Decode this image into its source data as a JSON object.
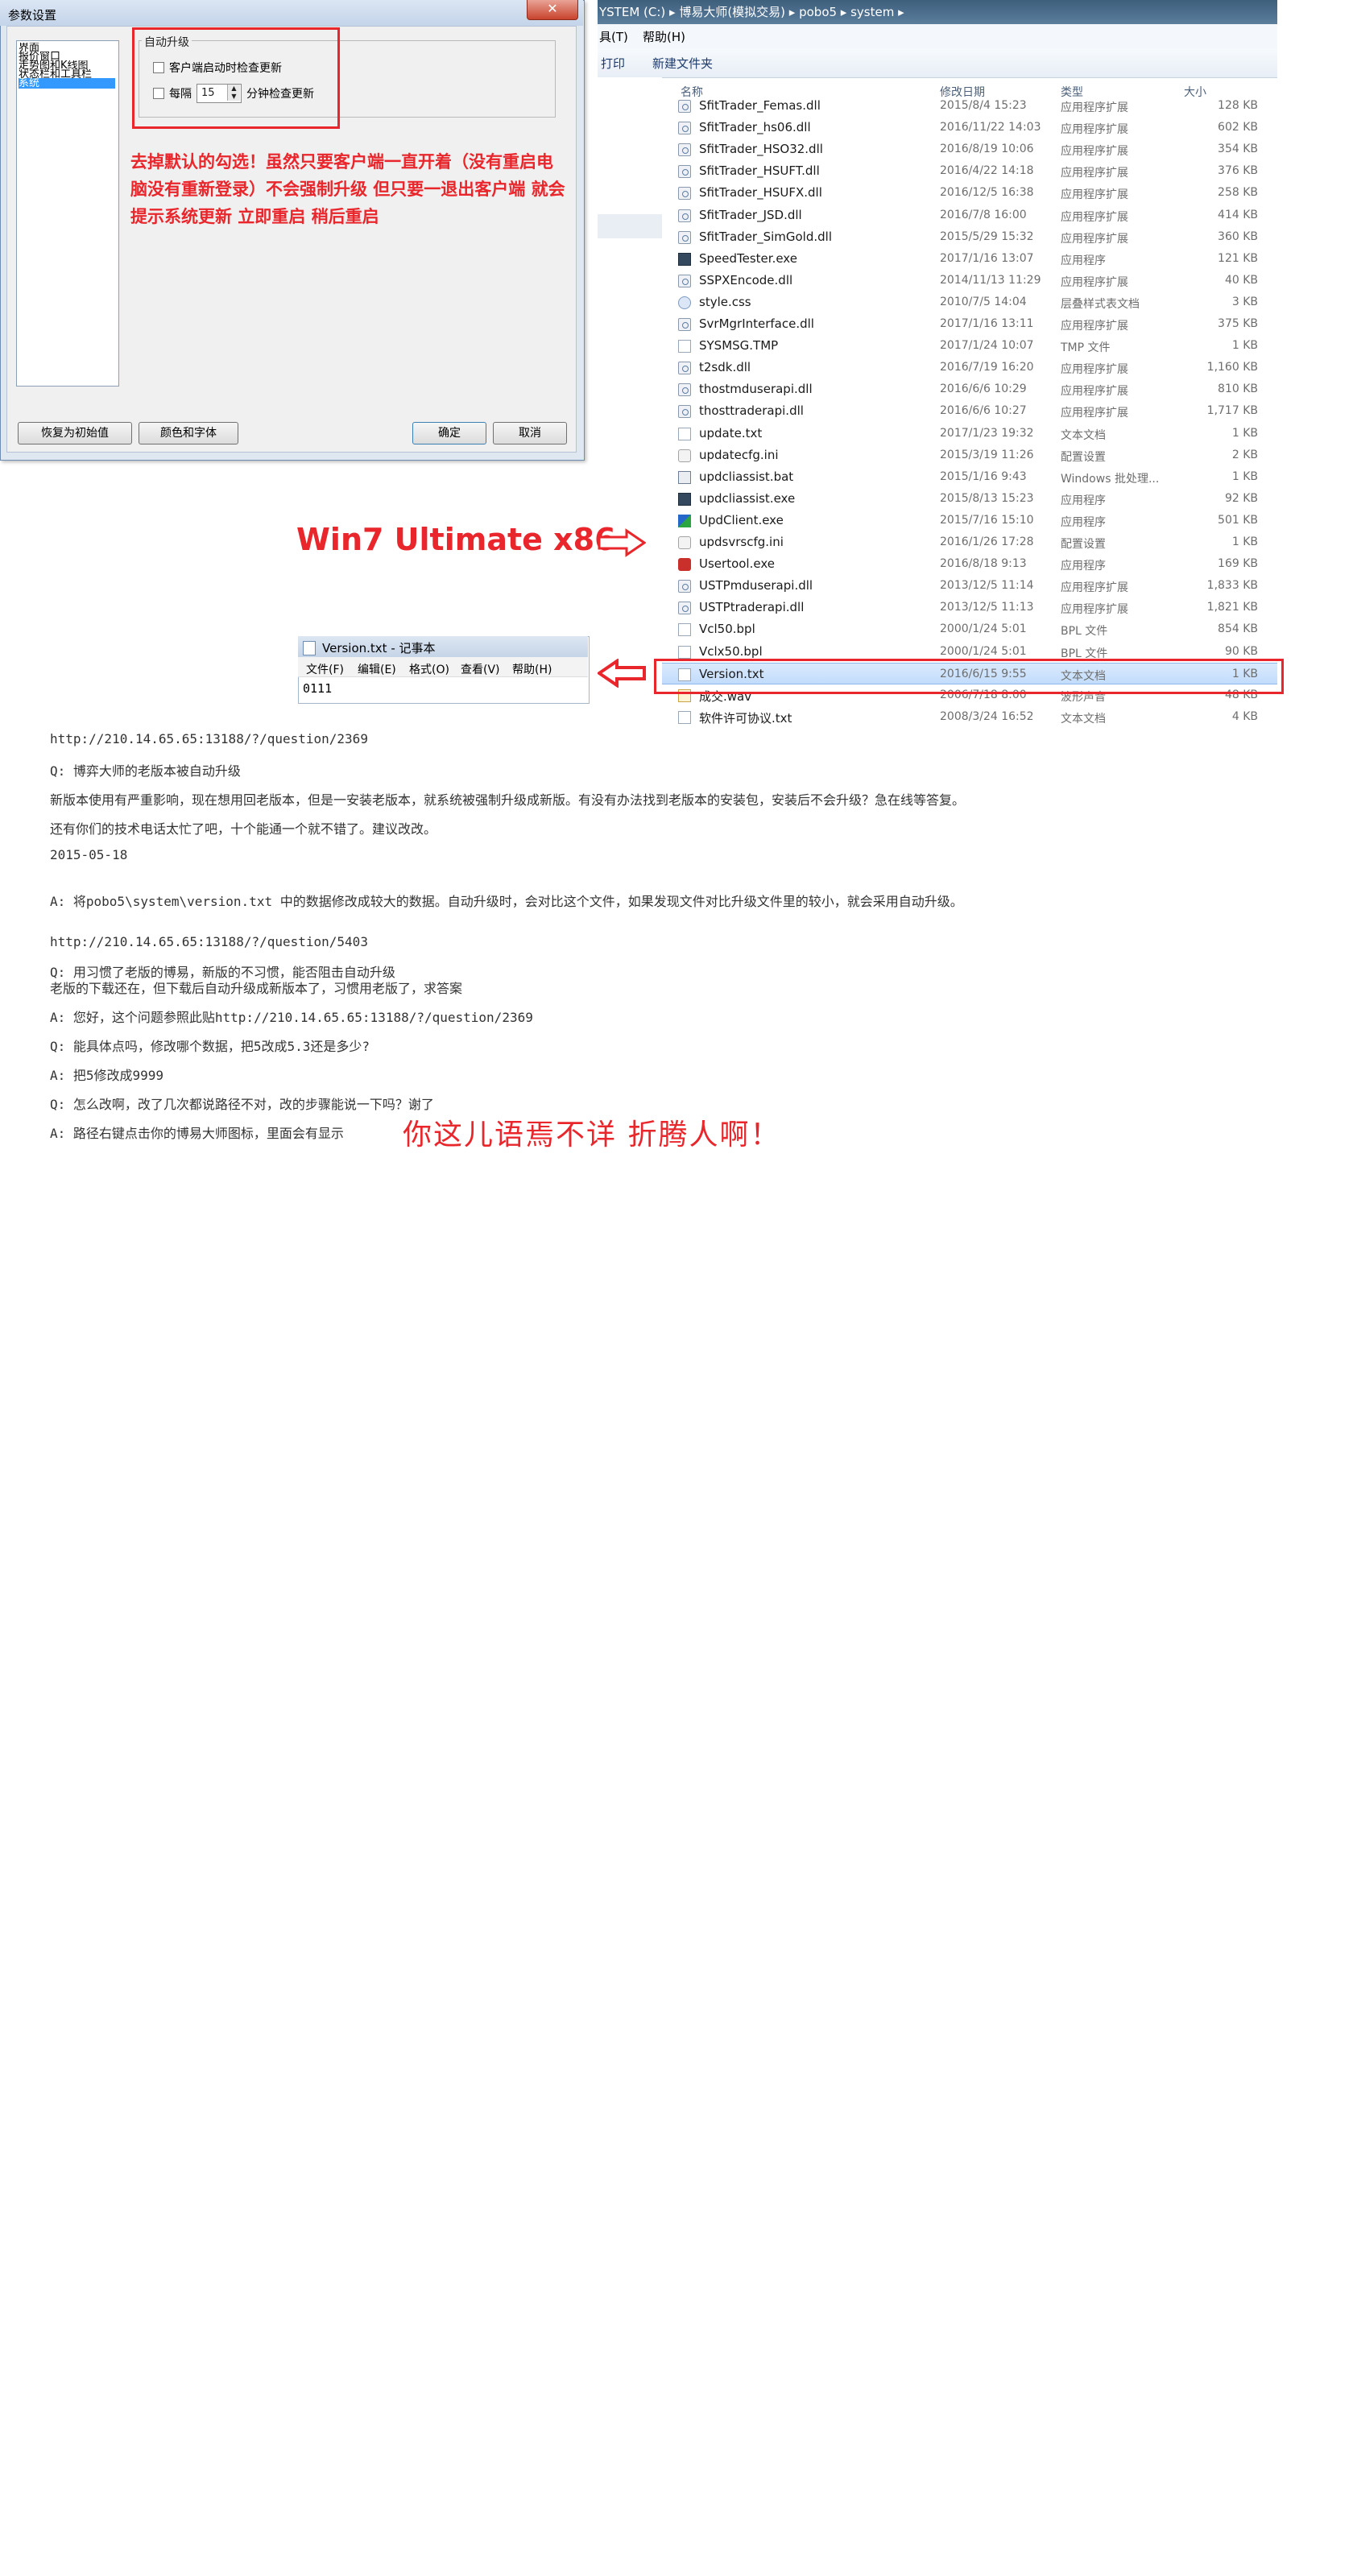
{
  "dialog": {
    "title": "参数设置",
    "close_glyph": "✕",
    "tree_items": [
      "界面",
      "报价窗口",
      "走势图和K线图",
      "状态栏和工具栏",
      "系统"
    ],
    "group_title": "自动升级",
    "check_on_startup_label": "客户端启动时检查更新",
    "every_label": "每隔",
    "interval_value": "15",
    "minutes_label": "分钟检查更新",
    "buttons": {
      "reset": "恢复为初始值",
      "color_font": "颜色和字体",
      "ok": "确定",
      "cancel": "取消"
    }
  },
  "red_note": "去掉默认的勾选！虽然只要客户端一直开着（没有重启电脑没有重新登录）不会强制升级 但只要一退出客户端 就会提示系统更新 立即重启 稍后重启",
  "explorer": {
    "address": "YSTEM (C:) ▸ 博易大师(模拟交易) ▸ pobo5 ▸ system ▸",
    "menu": [
      "具(T)",
      "帮助(H)"
    ],
    "toolbar": [
      "打印",
      "新建文件夹"
    ],
    "columns": {
      "name": "名称",
      "date": "修改日期",
      "type": "类型",
      "size": "大小"
    },
    "files": [
      {
        "name": "SfitTrader_Femas.dll",
        "date": "2015/8/4 15:23",
        "type": "应用程序扩展",
        "size": "128 KB",
        "icon": "dll-icon"
      },
      {
        "name": "SfitTrader_hs06.dll",
        "date": "2016/11/22 14:03",
        "type": "应用程序扩展",
        "size": "602 KB",
        "icon": "dll-icon"
      },
      {
        "name": "SfitTrader_HSO32.dll",
        "date": "2016/8/19 10:06",
        "type": "应用程序扩展",
        "size": "354 KB",
        "icon": "dll-icon"
      },
      {
        "name": "SfitTrader_HSUFT.dll",
        "date": "2016/4/22 14:18",
        "type": "应用程序扩展",
        "size": "376 KB",
        "icon": "dll-icon"
      },
      {
        "name": "SfitTrader_HSUFX.dll",
        "date": "2016/12/5 16:38",
        "type": "应用程序扩展",
        "size": "258 KB",
        "icon": "dll-icon"
      },
      {
        "name": "SfitTrader_JSD.dll",
        "date": "2016/7/8 16:00",
        "type": "应用程序扩展",
        "size": "414 KB",
        "icon": "dll-icon"
      },
      {
        "name": "SfitTrader_SimGold.dll",
        "date": "2015/5/29 15:32",
        "type": "应用程序扩展",
        "size": "360 KB",
        "icon": "dll-icon"
      },
      {
        "name": "SpeedTester.exe",
        "date": "2017/1/16 13:07",
        "type": "应用程序",
        "size": "121 KB",
        "icon": "exe-icon"
      },
      {
        "name": "SSPXEncode.dll",
        "date": "2014/11/13 11:29",
        "type": "应用程序扩展",
        "size": "40 KB",
        "icon": "dll-icon"
      },
      {
        "name": "style.css",
        "date": "2010/7/5 14:04",
        "type": "层叠样式表文档",
        "size": "3 KB",
        "icon": "css-icon"
      },
      {
        "name": "SvrMgrInterface.dll",
        "date": "2017/1/16 13:11",
        "type": "应用程序扩展",
        "size": "375 KB",
        "icon": "dll-icon"
      },
      {
        "name": "SYSMSG.TMP",
        "date": "2017/1/24 10:07",
        "type": "TMP 文件",
        "size": "1 KB",
        "icon": "file-icon"
      },
      {
        "name": "t2sdk.dll",
        "date": "2016/7/19 16:20",
        "type": "应用程序扩展",
        "size": "1,160 KB",
        "icon": "dll-icon"
      },
      {
        "name": "thostmduserapi.dll",
        "date": "2016/6/6 10:29",
        "type": "应用程序扩展",
        "size": "810 KB",
        "icon": "dll-icon"
      },
      {
        "name": "thosttraderapi.dll",
        "date": "2016/6/6 10:27",
        "type": "应用程序扩展",
        "size": "1,717 KB",
        "icon": "dll-icon"
      },
      {
        "name": "update.txt",
        "date": "2017/1/23 19:32",
        "type": "文本文档",
        "size": "1 KB",
        "icon": "file-icon"
      },
      {
        "name": "updatecfg.ini",
        "date": "2015/3/19 11:26",
        "type": "配置设置",
        "size": "2 KB",
        "icon": "ini-icon"
      },
      {
        "name": "updcliassist.bat",
        "date": "2015/1/16 9:43",
        "type": "Windows 批处理...",
        "size": "1 KB",
        "icon": "bat-icon"
      },
      {
        "name": "updcliassist.exe",
        "date": "2015/8/13 15:23",
        "type": "应用程序",
        "size": "92 KB",
        "icon": "exe-icon"
      },
      {
        "name": "UpdClient.exe",
        "date": "2015/7/16 15:10",
        "type": "应用程序",
        "size": "501 KB",
        "icon": "updclient-icon"
      },
      {
        "name": "updsvrscfg.ini",
        "date": "2016/1/26 17:28",
        "type": "配置设置",
        "size": "1 KB",
        "icon": "ini-icon"
      },
      {
        "name": "Usertool.exe",
        "date": "2016/8/18 9:13",
        "type": "应用程序",
        "size": "169 KB",
        "icon": "usertool-icon"
      },
      {
        "name": "USTPmduserapi.dll",
        "date": "2013/12/5 11:14",
        "type": "应用程序扩展",
        "size": "1,833 KB",
        "icon": "dll-icon"
      },
      {
        "name": "USTPtraderapi.dll",
        "date": "2013/12/5 11:13",
        "type": "应用程序扩展",
        "size": "1,821 KB",
        "icon": "dll-icon"
      },
      {
        "name": "Vcl50.bpl",
        "date": "2000/1/24 5:01",
        "type": "BPL 文件",
        "size": "854 KB",
        "icon": "file-icon"
      },
      {
        "name": "Vclx50.bpl",
        "date": "2000/1/24 5:01",
        "type": "BPL 文件",
        "size": "90 KB",
        "icon": "file-icon"
      },
      {
        "name": "Version.txt",
        "date": "2016/6/15 9:55",
        "type": "文本文档",
        "size": "1 KB",
        "icon": "file-icon"
      },
      {
        "name": "成交.wav",
        "date": "2006/7/18 8:00",
        "type": "波形声音",
        "size": "48 KB",
        "icon": "wav-icon"
      },
      {
        "name": "软件许可协议.txt",
        "date": "2008/3/24 16:52",
        "type": "文本文档",
        "size": "4 KB",
        "icon": "file-icon"
      }
    ]
  },
  "annotation_label": "Win7 Ultimate x86",
  "notepad": {
    "title": "Version.txt - 记事本",
    "menu": [
      "文件(F)",
      "编辑(E)",
      "格式(O)",
      "查看(V)",
      "帮助(H)"
    ],
    "content": "0111"
  },
  "forum": [
    "http://210.14.65.65:13188/?/question/2369",
    "Q: 博弈大师的老版本被自动升级",
    "新版本使用有严重影响，现在想用回老版本，但是一安装老版本，就系统被强制升级成新版。有没有办法找到老版本的安装包，安装后不会升级？急在线等答复。",
    "还有你们的技术电话太忙了吧，十个能通一个就不错了。建议改改。",
    "2015-05-18",
    "A: 将pobo5\\system\\version.txt 中的数据修改成较大的数据。自动升级时，会对比这个文件，如果发现文件对比升级文件里的较小，就会采用自动升级。",
    "http://210.14.65.65:13188/?/question/5403",
    "Q: 用习惯了老版的博易，新版的不习惯，能否阻击自动升级",
    "老版的下载还在，但下载后自动升级成新版本了，习惯用老版了，求答案",
    "A: 您好，这个问题参照此贴http://210.14.65.65:13188/?/question/2369",
    "Q: 能具体点吗，修改哪个数据，把5改成5.3还是多少?",
    "A: 把5修改成9999",
    "Q: 怎么改啊，改了几次都说路径不对，改的步骤能说一下吗？谢了",
    "A: 路径右键点击你的博易大师图标，里面会有显示"
  ],
  "handwritten_comment": "你这儿语焉不详 折腾人啊！",
  "colors": {
    "annotation_red": "#e8262b",
    "selection_blue": "#3399ff",
    "row_highlight": "#cce4fc"
  }
}
